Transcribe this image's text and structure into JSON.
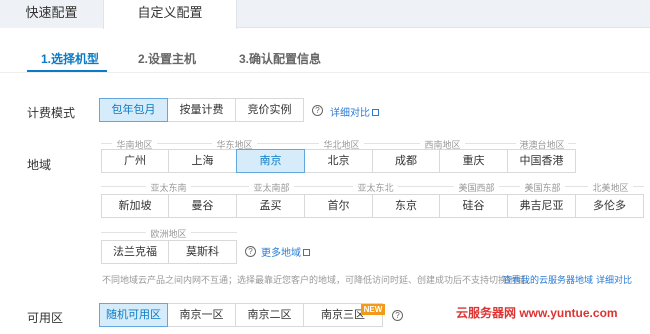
{
  "top_tabs": [
    "快速配置",
    "自定义配置"
  ],
  "steps": [
    "1.选择机型",
    "2.设置主机",
    "3.确认配置信息"
  ],
  "billing": {
    "label": "计费模式",
    "options": [
      "包年包月",
      "按量计费",
      "竞价实例"
    ],
    "selected": "包年包月",
    "link": "详细对比"
  },
  "region": {
    "label": "地域",
    "groups_row1": [
      "华南地区",
      "华东地区",
      "华北地区",
      "西南地区",
      "港澳台地区"
    ],
    "row1": [
      "广州",
      "上海",
      "南京",
      "北京",
      "成都",
      "重庆",
      "中国香港"
    ],
    "groups_row2": [
      "亚太东南",
      "亚太南部",
      "亚太东北",
      "美国西部",
      "美国东部",
      "北美地区"
    ],
    "row2": [
      "新加坡",
      "曼谷",
      "孟买",
      "首尔",
      "东京",
      "硅谷",
      "弗吉尼亚",
      "多伦多"
    ],
    "groups_row3": [
      "欧洲地区"
    ],
    "row3": [
      "法兰克福",
      "莫斯科"
    ],
    "selected": "南京",
    "more_link": "更多地域",
    "note": "不同地域云产品之间内网不互通；选择最靠近您客户的地域，可降低访问时延、创建成功后不支持切换地域。",
    "note_link1": "查看我的云服务器地域",
    "note_link2": "详细对比"
  },
  "zone": {
    "label": "可用区",
    "options": [
      "随机可用区",
      "南京一区",
      "南京二区",
      "南京三区"
    ],
    "selected": "随机可用区",
    "badge": "NEW"
  },
  "watermark": "云服务器网 www.yuntue.com",
  "colors": {
    "accent": "#0a7bc4",
    "selected_bg": "#d6ecfb",
    "badge": "#f19a1b"
  }
}
